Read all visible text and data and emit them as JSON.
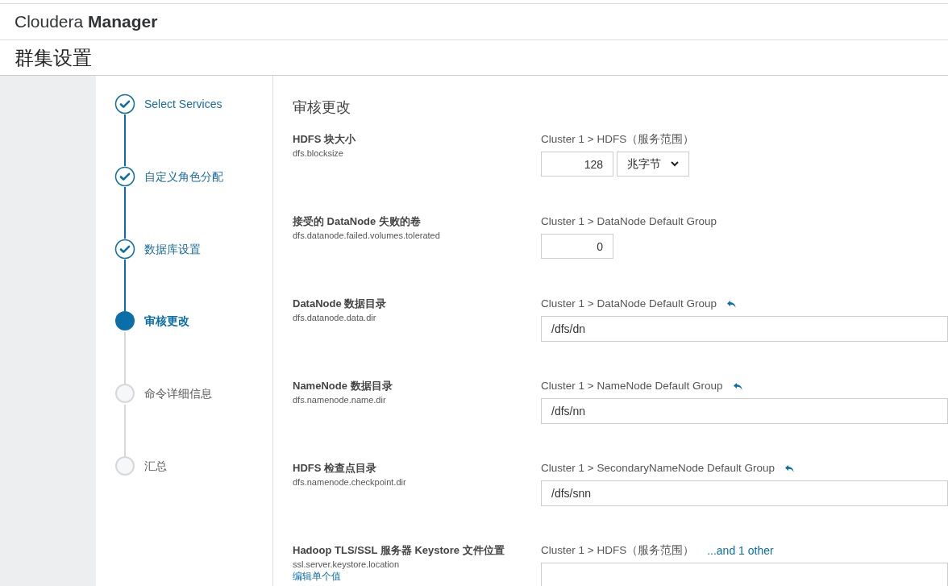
{
  "header": {
    "brand_light": "Cloudera",
    "brand_bold": "Manager"
  },
  "page_title": "群集设置",
  "steps": [
    {
      "label": "Select Services",
      "completed": true,
      "selected": false
    },
    {
      "label": "自定义角色分配",
      "completed": true,
      "selected": false
    },
    {
      "label": "数据库设置",
      "completed": true,
      "selected": false
    },
    {
      "label": "审核更改",
      "completed": false,
      "selected": true
    },
    {
      "label": "命令详细信息",
      "completed": false,
      "selected": false
    },
    {
      "label": "汇总",
      "completed": false,
      "selected": false
    }
  ],
  "section_title": "审核更改",
  "settings": [
    {
      "label": "HDFS 块大小",
      "key": "dfs.blocksize",
      "scope": "Cluster 1 > HDFS（服务范围）",
      "revert": false,
      "kind": "number_unit",
      "value": "128",
      "unit": "兆字节"
    },
    {
      "label": "接受的 DataNode 失败的卷",
      "key": "dfs.datanode.failed.volumes.tolerated",
      "scope": "Cluster 1 > DataNode Default Group",
      "revert": false,
      "kind": "number",
      "value": "0"
    },
    {
      "label": "DataNode 数据目录",
      "key": "dfs.datanode.data.dir",
      "scope": "Cluster 1 > DataNode Default Group",
      "revert": true,
      "kind": "text",
      "value": "/dfs/dn"
    },
    {
      "label": "NameNode 数据目录",
      "key": "dfs.namenode.name.dir",
      "scope": "Cluster 1 > NameNode Default Group",
      "revert": true,
      "kind": "text",
      "value": "/dfs/nn"
    },
    {
      "label": "HDFS 检查点目录",
      "key": "dfs.namenode.checkpoint.dir",
      "scope": "Cluster 1 > SecondaryNameNode Default Group",
      "revert": true,
      "kind": "text",
      "value": "/dfs/snn"
    },
    {
      "label": "Hadoop TLS/SSL 服务器 Keystore 文件位置",
      "key": "ssl.server.keystore.location",
      "scope": "Cluster 1 > HDFS（服务范围）",
      "revert": false,
      "kind": "text",
      "others_link": "...and 1 other",
      "edit_link": "编辑单个值"
    }
  ]
}
